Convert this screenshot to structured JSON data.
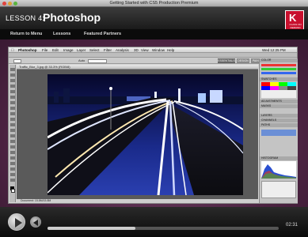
{
  "window": {
    "title": "Getting Started with CS5 Production Premium"
  },
  "header": {
    "lesson_label": "LESSON 4:",
    "lesson_title": "Photoshop",
    "logo_text": "K",
    "logo_subtext": "CLASS ON DEMAND"
  },
  "nav": {
    "items": [
      "Return to Menu",
      "Lessons",
      "Featured Partners"
    ]
  },
  "photoshop": {
    "menus": [
      "Photoshop",
      "File",
      "Edit",
      "Image",
      "Layer",
      "Select",
      "Filter",
      "Analysis",
      "3D",
      "View",
      "Window",
      "Help"
    ],
    "status_time": "Wed 12:25 PM",
    "options_label": "Auto",
    "workspace_buttons": [
      "ESSENTIALS",
      "DESIGN",
      "PAINTING"
    ],
    "doc_tab": "Traffic_Blur_3.jpg @ 33.3% (RGB/8)",
    "doc_status": "Document: 15.8M/15.8M",
    "panel_tabs": [
      "COLOR",
      "SWATCHES",
      "ADJUSTMENTS",
      "MASKS",
      "LAYERS",
      "CHANNELS",
      "PATHS",
      "HISTOGRAM"
    ]
  },
  "player": {
    "timecode": "02:31",
    "progress": 0.38
  },
  "colors": {
    "purple": "#4a2240",
    "brand_red": "#c8102e"
  }
}
